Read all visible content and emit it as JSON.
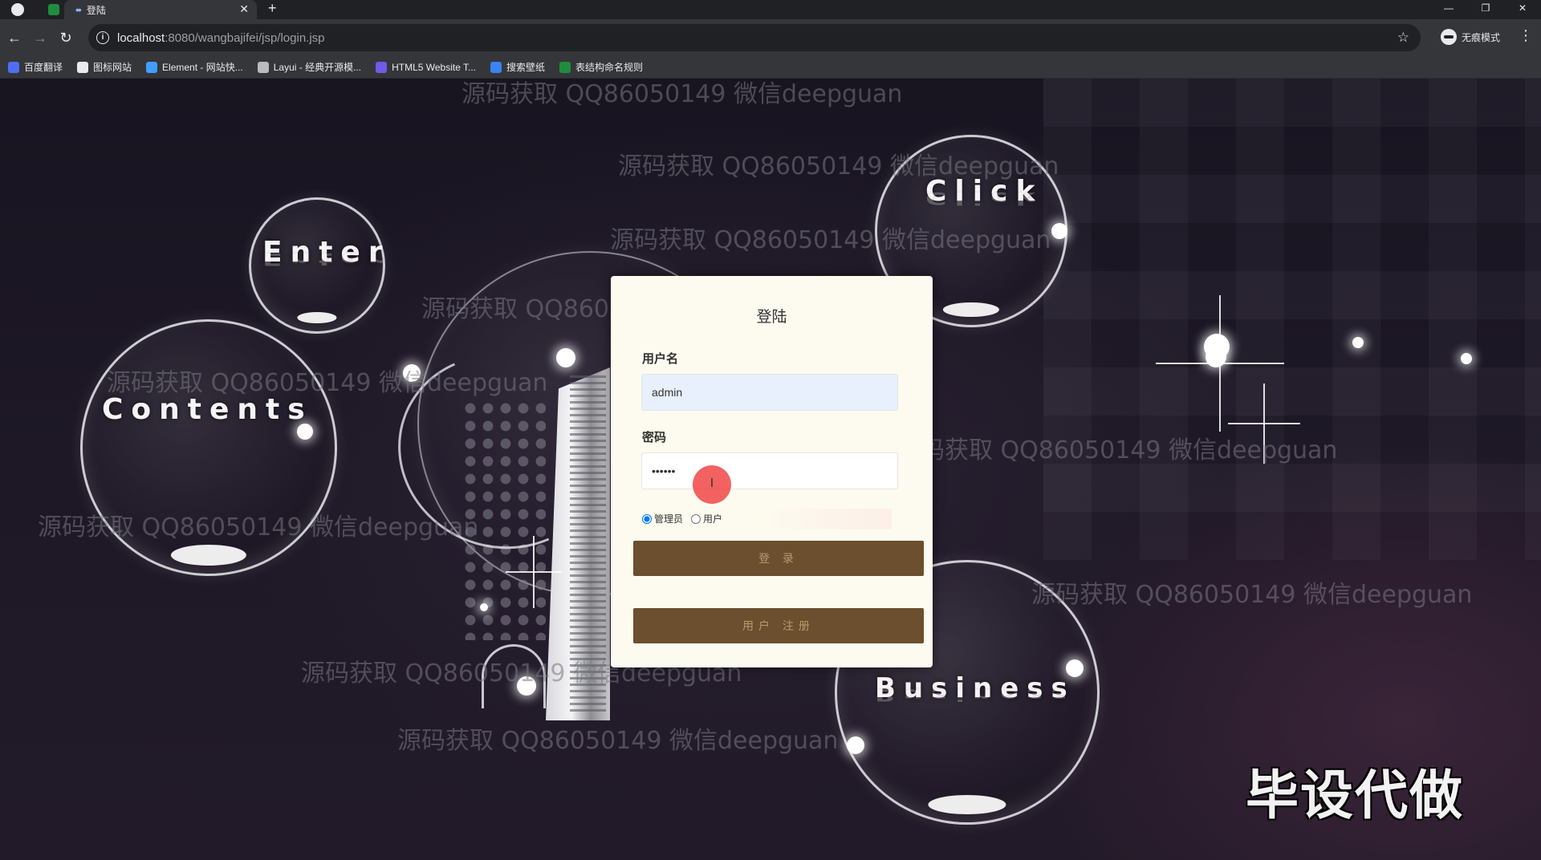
{
  "browser": {
    "tab_title": "登陆",
    "url_host": "localhost",
    "url_rest": ":8080/wangbajifei/jsp/login.jsp",
    "incognito_label": "无痕模式",
    "bookmarks": [
      {
        "label": "百度翻译",
        "color": "#4e6ef2"
      },
      {
        "label": "图标网站",
        "color": "#e8eaed"
      },
      {
        "label": "Element - 网站快...",
        "color": "#409eff"
      },
      {
        "label": "Layui - 经典开源模...",
        "color": "#bbbbbb"
      },
      {
        "label": "HTML5 Website T...",
        "color": "#6d5ce8"
      },
      {
        "label": "搜索壁纸",
        "color": "#3b82f6"
      },
      {
        "label": "表结构命名规则",
        "color": "#1e8e3e"
      }
    ]
  },
  "scene": {
    "bubble_words": [
      "Enter",
      "Contents",
      "Click",
      "Business"
    ],
    "watermark_text": "源码获取 QQ86050149 微信deepguan",
    "corner_badge": "毕设代做"
  },
  "login": {
    "title": "登陆",
    "username_label": "用户名",
    "username_value": "admin",
    "password_label": "密码",
    "password_value": "••••••",
    "cursor_glyph": "I",
    "roles": [
      {
        "label": "管理员",
        "checked": true
      },
      {
        "label": "用户",
        "checked": false
      }
    ],
    "login_button": "登 录",
    "register_button": "用户 注册"
  },
  "colors": {
    "card_bg": "#fdfbef",
    "button_bg": "#6b4f2e",
    "button_text": "#b99a6e",
    "autofill_bg": "#e8f0fe"
  }
}
